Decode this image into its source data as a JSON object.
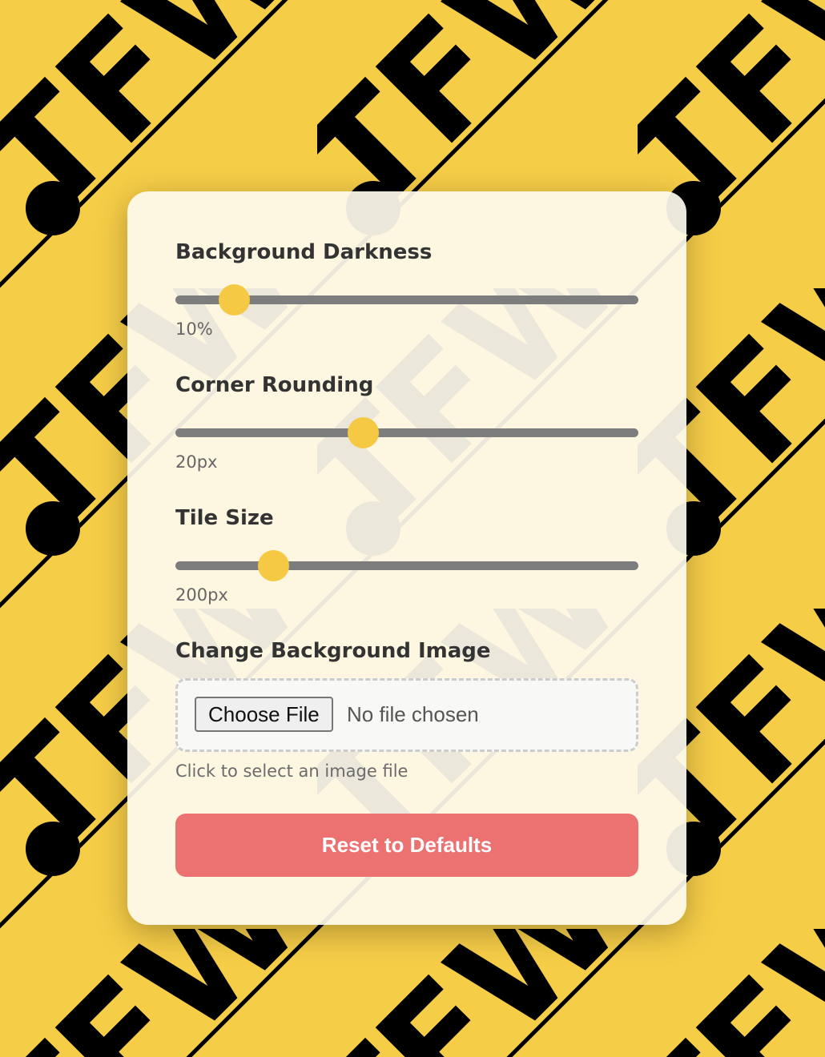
{
  "background": {
    "pattern_color": "#f6cd47",
    "ink_color": "#000000",
    "tile_text": "TFW"
  },
  "controls": {
    "darkness": {
      "label": "Background Darkness",
      "value_text": "10%",
      "fraction": 0.126
    },
    "rounding": {
      "label": "Corner Rounding",
      "value_text": "20px",
      "fraction": 0.405
    },
    "tile_size": {
      "label": "Tile Size",
      "value_text": "200px",
      "fraction": 0.211
    }
  },
  "upload": {
    "label": "Change Background Image",
    "button_label": "Choose File",
    "status": "No file chosen",
    "hint": "Click to select an image file"
  },
  "reset_label": "Reset to Defaults",
  "colors": {
    "accent": "#f6c945",
    "reset": "#ec7272",
    "panel": "#fdf9ec"
  }
}
